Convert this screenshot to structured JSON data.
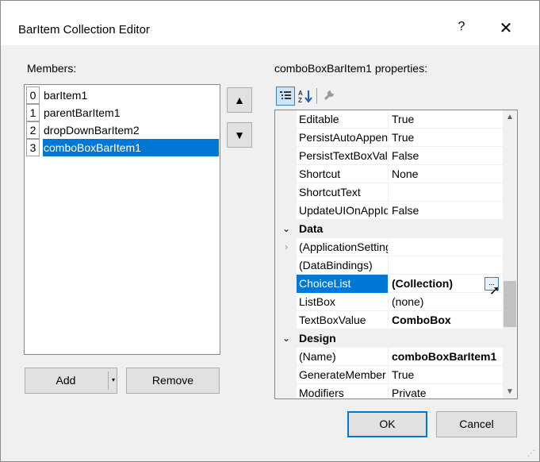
{
  "window": {
    "title": "BarItem Collection Editor",
    "help_label": "?",
    "close_label": "✕"
  },
  "members": {
    "label": "Members:",
    "items": [
      {
        "index": "0",
        "name": "barItem1",
        "selected": false
      },
      {
        "index": "1",
        "name": "parentBarItem1",
        "selected": false
      },
      {
        "index": "2",
        "name": "dropDownBarItem2",
        "selected": false
      },
      {
        "index": "3",
        "name": "comboBoxBarItem1",
        "selected": true
      }
    ],
    "move_up_icon": "▲",
    "move_down_icon": "▼"
  },
  "buttons": {
    "add": "Add",
    "add_caret": "▾",
    "remove": "Remove",
    "ok": "OK",
    "cancel": "Cancel"
  },
  "properties": {
    "label": "comboBoxBarItem1 properties:",
    "toolbar": {
      "categorized_icon": "categorized-icon",
      "alphabetical_icon": "alphabetical-icon",
      "property_pages_icon": "wrench-icon"
    },
    "rows": [
      {
        "kind": "prop",
        "name": "Editable",
        "value": "True"
      },
      {
        "kind": "prop",
        "name": "PersistAutoAppend",
        "value": "True"
      },
      {
        "kind": "prop",
        "name": "PersistTextBoxValue",
        "value": "False"
      },
      {
        "kind": "prop",
        "name": "Shortcut",
        "value": "None"
      },
      {
        "kind": "prop",
        "name": "ShortcutText",
        "value": ""
      },
      {
        "kind": "prop",
        "name": "UpdateUIOnAppIdle",
        "value": "False"
      },
      {
        "kind": "category",
        "name": "Data",
        "toggle": "⌄"
      },
      {
        "kind": "prop",
        "name": "(ApplicationSettings)",
        "value": "",
        "expandable": true,
        "expander": "›"
      },
      {
        "kind": "prop",
        "name": "(DataBindings)",
        "value": ""
      },
      {
        "kind": "prop",
        "name": "ChoiceList",
        "value": "(Collection)",
        "bold": true,
        "selected": true,
        "ellipsis": "..."
      },
      {
        "kind": "prop",
        "name": "ListBox",
        "value": "(none)"
      },
      {
        "kind": "prop",
        "name": "TextBoxValue",
        "value": "ComboBox",
        "bold": true
      },
      {
        "kind": "category",
        "name": "Design",
        "toggle": "⌄"
      },
      {
        "kind": "prop",
        "name": "(Name)",
        "value": "comboBoxBarItem1",
        "bold": true
      },
      {
        "kind": "prop",
        "name": "GenerateMember",
        "value": "True"
      },
      {
        "kind": "prop",
        "name": "Modifiers",
        "value": "Private"
      }
    ],
    "scroll": {
      "up": "▲",
      "down": "▼"
    }
  },
  "colors": {
    "selection": "#0078d7",
    "accent_border": "#0078d7"
  }
}
